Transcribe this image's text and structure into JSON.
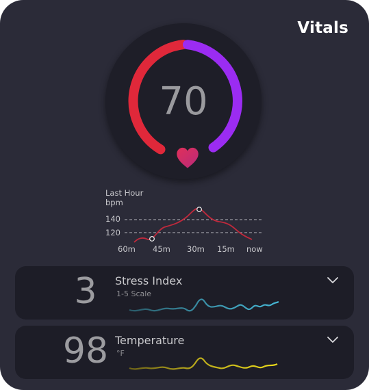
{
  "app": {
    "title": "Vitals"
  },
  "heart_rate": {
    "value": "70",
    "icon": "heart-icon"
  },
  "mini_chart": {
    "caption_line1": "Last Hour",
    "caption_line2": "bpm",
    "ref_lines": [
      "140",
      "120"
    ],
    "x_labels": [
      "60m",
      "45m",
      "30m",
      "15m",
      "now"
    ]
  },
  "stress": {
    "value": "3",
    "label": "Stress Index",
    "sub": "1-5 Scale",
    "icon": "chevron-down-icon"
  },
  "temperature": {
    "value": "98",
    "label": "Temperature",
    "sub": "°F",
    "icon": "chevron-down-icon"
  },
  "colors": {
    "card_bg": "#2b2b38",
    "gauge_red": "#e0283a",
    "gauge_purple": "#9b2cf2",
    "heart": "#d0306a",
    "chart_line": "#c0293c",
    "stress_spark": "#3aa9c0",
    "temp_spark": "#d4c218"
  }
}
